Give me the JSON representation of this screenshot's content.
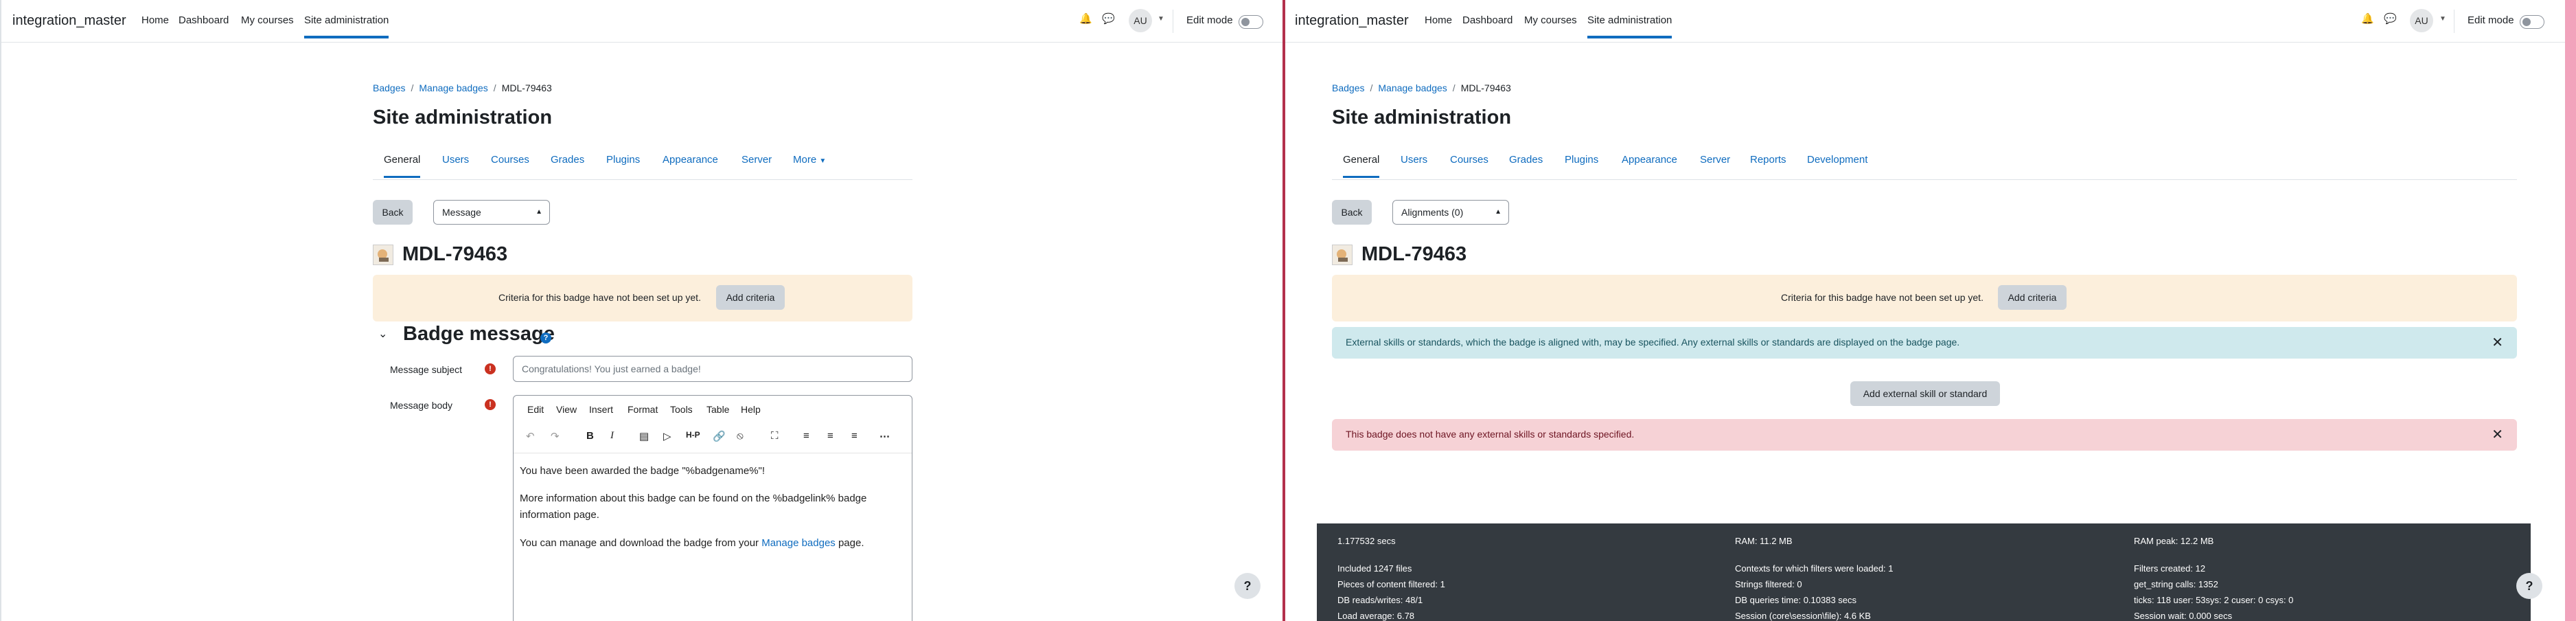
{
  "left": {
    "brand": "integration_master",
    "nav": {
      "home": "Home",
      "dashboard": "Dashboard",
      "my_courses": "My courses",
      "site_admin": "Site administration"
    },
    "user_initials": "AU",
    "edit_mode": "Edit mode",
    "breadcrumb": {
      "badges": "Badges",
      "manage": "Manage badges",
      "current": "MDL-79463"
    },
    "page_title": "Site administration",
    "tabs": {
      "general": "General",
      "users": "Users",
      "courses": "Courses",
      "grades": "Grades",
      "plugins": "Plugins",
      "appearance": "Appearance",
      "server": "Server",
      "more": "More"
    },
    "back": "Back",
    "select_value": "Message",
    "badge_name": "MDL-79463",
    "criteria_text": "Criteria for this badge have not been set up yet.",
    "add_criteria": "Add criteria",
    "section_title": "Badge message",
    "subject_label": "Message subject",
    "subject_value": "Congratulations! You just earned a badge!",
    "body_label": "Message body",
    "editor_menu": {
      "edit": "Edit",
      "view": "View",
      "insert": "Insert",
      "format": "Format",
      "tools": "Tools",
      "table": "Table",
      "help": "Help"
    },
    "editor_body": {
      "p1": "You have been awarded the badge \"%badgename%\"!",
      "p2a": "More information about this badge can be found on the %badgelink% badge",
      "p2b": "information page.",
      "p3_pre": "You can manage and download the badge from your ",
      "p3_link": "Manage badges",
      "p3_post": " page."
    },
    "help_button": "?"
  },
  "right": {
    "brand": "integration_master",
    "nav": {
      "home": "Home",
      "dashboard": "Dashboard",
      "my_courses": "My courses",
      "site_admin": "Site administration"
    },
    "user_initials": "AU",
    "edit_mode": "Edit mode",
    "breadcrumb": {
      "badges": "Badges",
      "manage": "Manage badges",
      "current": "MDL-79463"
    },
    "page_title": "Site administration",
    "tabs": {
      "general": "General",
      "users": "Users",
      "courses": "Courses",
      "grades": "Grades",
      "plugins": "Plugins",
      "appearance": "Appearance",
      "server": "Server",
      "reports": "Reports",
      "development": "Development"
    },
    "back": "Back",
    "select_value": "Alignments (0)",
    "badge_name": "MDL-79463",
    "criteria_text": "Criteria for this badge have not been set up yet.",
    "add_criteria": "Add criteria",
    "info_text": "External skills or standards, which the badge is aligned with, may be specified. Any external skills or standards are displayed on the badge page.",
    "add_external": "Add external skill or standard",
    "danger_text": "This badge does not have any external skills or standards specified.",
    "footer": {
      "secs": "1.177532 secs",
      "ram": "RAM: 11.2 MB",
      "ram_peak": "RAM peak: 12.2 MB",
      "included": "Included 1247 files",
      "contexts": "Contexts for which filters were loaded: 1",
      "filters_created": "Filters created: 12",
      "pieces": "Pieces of content filtered: 1",
      "strings": "Strings filtered: 0",
      "get_string": "get_string calls: 1352",
      "db_rw": "DB reads/writes: 48/1",
      "db_time": "DB queries time: 0.10383 secs",
      "ticks": "ticks: 118 user: 53sys: 2 cuser: 0 csys: 0",
      "load": "Load average: 6.78",
      "session": "Session (core\\session\\file): 4.6 KB",
      "session_wait": "Session wait: 0.000 secs"
    },
    "help_button": "?"
  }
}
